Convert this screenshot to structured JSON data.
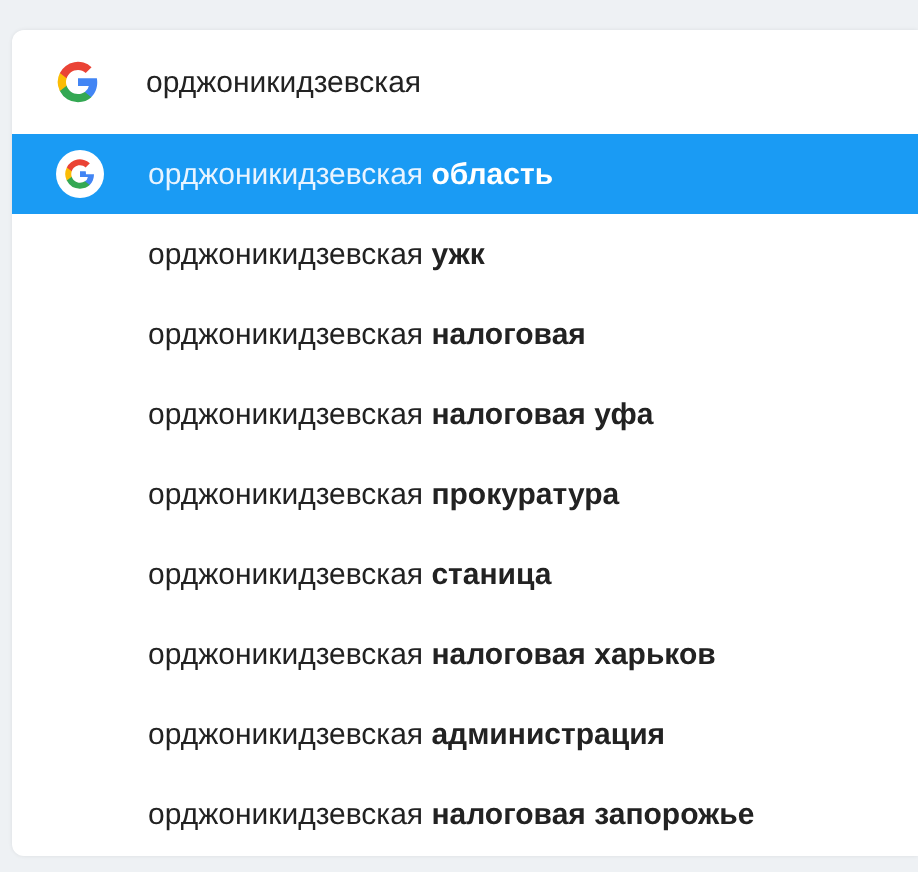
{
  "search": {
    "value": "орджоникидзевская"
  },
  "suggestions": [
    {
      "text": "орджоникидзевская **область**",
      "selected": true
    },
    {
      "text": "орджоникидзевская **ужк**",
      "selected": false
    },
    {
      "text": "орджоникидзевская **налоговая**",
      "selected": false
    },
    {
      "text": "орджоникидзевская **налоговая уфа**",
      "selected": false
    },
    {
      "text": "орджоникидзевская **прокуратура**",
      "selected": false
    },
    {
      "text": "орджоникидзевская **станица**",
      "selected": false
    },
    {
      "text": "орджоникидзевская **налоговая харьков**",
      "selected": false
    },
    {
      "text": "орджоникидзевская **администрация**",
      "selected": false
    },
    {
      "text": "орджоникидзевская **налоговая запорожье**",
      "selected": false
    }
  ]
}
